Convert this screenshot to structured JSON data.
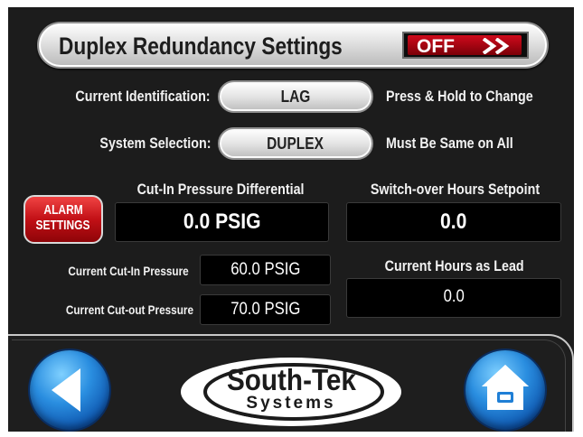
{
  "title": "Duplex Redundancy Settings",
  "toggle": {
    "label": "OFF",
    "color": "#c8101c"
  },
  "identification": {
    "label": "Current Identification:",
    "value": "LAG",
    "hint": "Press & Hold to Change"
  },
  "system": {
    "label": "System Selection:",
    "value": "DUPLEX",
    "hint": "Must Be Same on All"
  },
  "alarm": {
    "line1": "ALARM",
    "line2": "SETTINGS"
  },
  "cut_in_diff": {
    "label": "Cut-In Pressure Differential",
    "value": "0.0 PSIG"
  },
  "switchover": {
    "label": "Switch-over Hours Setpoint",
    "value": "0.0"
  },
  "cut_in_pressure": {
    "label": "Current Cut-In Pressure",
    "value": "60.0 PSIG"
  },
  "cut_out_pressure": {
    "label": "Current Cut-out Pressure",
    "value": "70.0 PSIG"
  },
  "hours_lead": {
    "label": "Current Hours as Lead",
    "value": "0.0"
  },
  "logo": {
    "main": "South-Tek",
    "sub": "Systems"
  },
  "nav": {
    "back_icon": "back-arrow-icon",
    "home_icon": "home-icon"
  },
  "colors": {
    "accent_blue": "#1f7fd6",
    "alarm_red": "#c8101c"
  }
}
